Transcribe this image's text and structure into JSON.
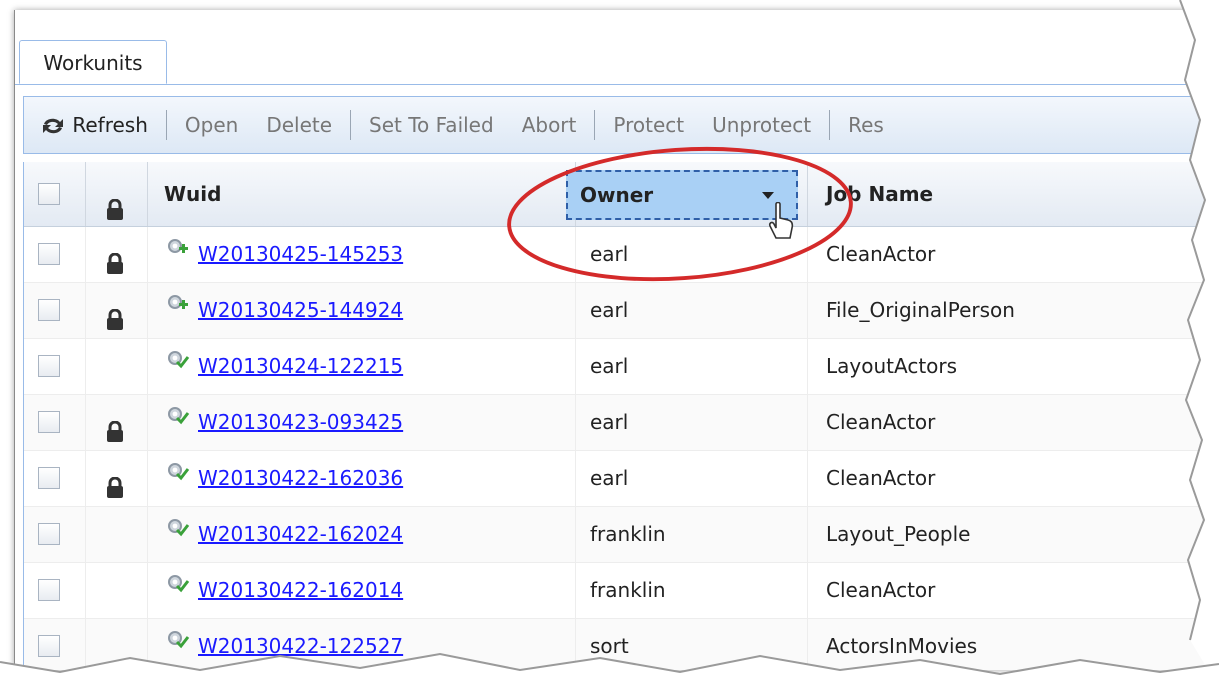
{
  "tabs": [
    {
      "label": "Workunits"
    }
  ],
  "toolbar": {
    "refresh": "Refresh",
    "open": "Open",
    "delete": "Delete",
    "set_to_failed": "Set To Failed",
    "abort": "Abort",
    "protect": "Protect",
    "unprotect": "Unprotect",
    "res": "Res"
  },
  "grid": {
    "headers": {
      "wuid": "Wuid",
      "owner": "Owner",
      "job_name": "Job Name"
    },
    "rows": [
      {
        "wuid": "W20130425-145253",
        "owner": "earl",
        "job_name": "CleanActor",
        "locked": true,
        "status_icon": "gear-running-icon"
      },
      {
        "wuid": "W20130425-144924",
        "owner": "earl",
        "job_name": "File_OriginalPerson",
        "locked": true,
        "status_icon": "gear-running-icon"
      },
      {
        "wuid": "W20130424-122215",
        "owner": "earl",
        "job_name": "LayoutActors",
        "locked": false,
        "status_icon": "gear-complete-icon"
      },
      {
        "wuid": "W20130423-093425",
        "owner": "earl",
        "job_name": "CleanActor",
        "locked": true,
        "status_icon": "gear-complete-icon"
      },
      {
        "wuid": "W20130422-162036",
        "owner": "earl",
        "job_name": "CleanActor",
        "locked": true,
        "status_icon": "gear-complete-icon"
      },
      {
        "wuid": "W20130422-162024",
        "owner": "franklin",
        "job_name": "Layout_People",
        "locked": false,
        "status_icon": "gear-complete-icon"
      },
      {
        "wuid": "W20130422-162014",
        "owner": "franklin",
        "job_name": "CleanActor",
        "locked": false,
        "status_icon": "gear-complete-icon"
      },
      {
        "wuid": "W20130422-122527",
        "owner": "sort",
        "job_name": "ActorsInMovies",
        "locked": false,
        "status_icon": "gear-complete-icon"
      }
    ]
  },
  "colors": {
    "link": "#1a1aff",
    "header_selected": "#a9d0f5",
    "annotation": "#d42a2a",
    "grid_border": "#99bbe8"
  }
}
